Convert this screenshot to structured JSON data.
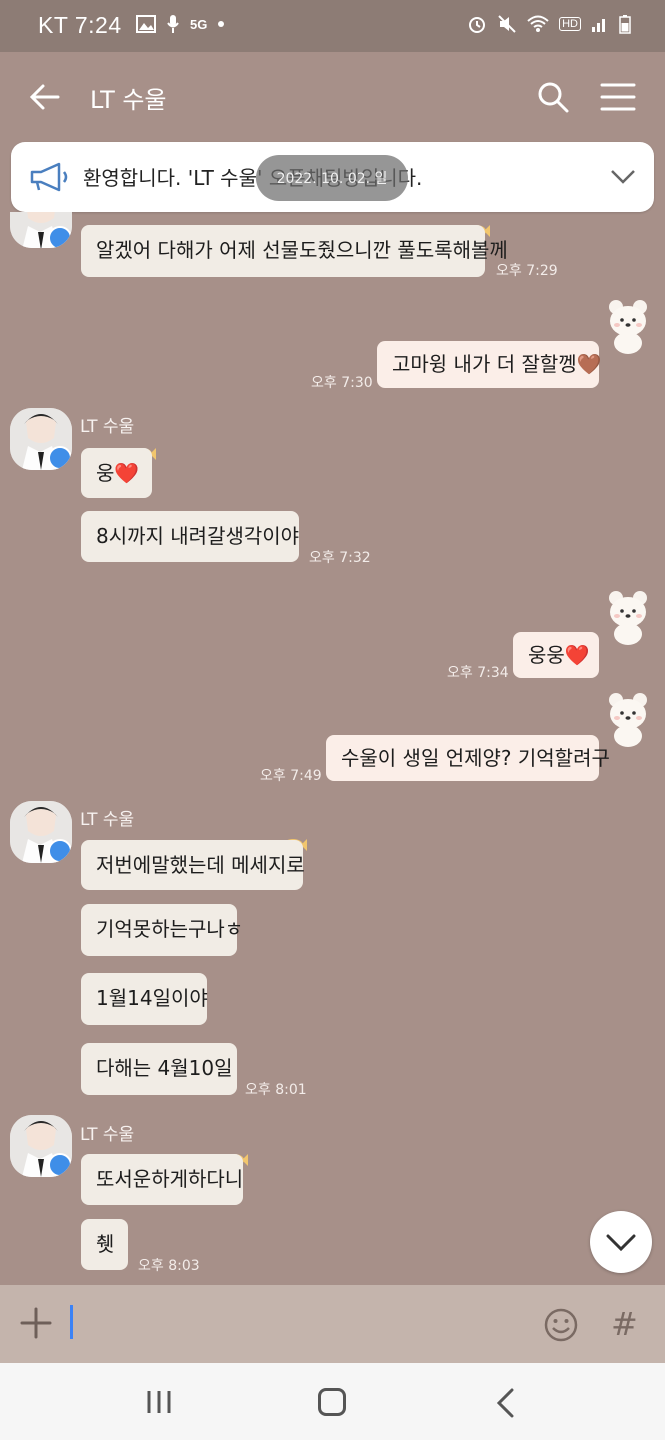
{
  "status_bar": {
    "carrier_time": "KT 7:24",
    "network_badge": "5G",
    "hd_badge": "HD"
  },
  "app_bar": {
    "room_title": "LT 수울",
    "icons": [
      "back-arrow-icon",
      "search-icon",
      "menu-icon"
    ]
  },
  "notice": {
    "text": "환영합니다. 'LT 수울' 오픈채팅방입니다.",
    "date_pill": "2022. 10. 02. 일"
  },
  "messages": [
    {
      "side": "in",
      "text": "알겠어 다해가 어제 선물도줬으니깐 풀도록해볼께",
      "time": "오후 7:29"
    },
    {
      "side": "out",
      "text": "고마윙 내가 더 잘할껭",
      "heart": "🤎",
      "time": "오후 7:30"
    },
    {
      "side": "in",
      "sender": "LT 수울",
      "text": "웅",
      "heart": "❤️"
    },
    {
      "side": "in",
      "text": "8시까지 내려갈생각이야",
      "time": "오후 7:32"
    },
    {
      "side": "out",
      "text": "웅웅",
      "heart": "❤️",
      "time": "오후 7:34"
    },
    {
      "side": "out",
      "text": "수울이 생일 언제양? 기억할려구",
      "time": "오후 7:49"
    },
    {
      "side": "in",
      "sender": "LT 수울",
      "text": "저번에말했는데 메세지로"
    },
    {
      "side": "in",
      "text": "기억못하는구나ㅎ"
    },
    {
      "side": "in",
      "text": "1월14일이야"
    },
    {
      "side": "in",
      "text": "다해는 4월10일",
      "time": "오후 8:01"
    },
    {
      "side": "in",
      "sender": "LT 수울",
      "text": "또서운하게하다니"
    },
    {
      "side": "in",
      "text": "췟",
      "time": "오후 8:03"
    }
  ],
  "input_bar": {
    "value": "",
    "icons": [
      "plus-icon",
      "emoji-icon",
      "hash-icon"
    ],
    "hash_label": "#"
  },
  "colors": {
    "chat_background": "#a79089",
    "incoming_bubble": "#f1ece5",
    "outgoing_bubble": "#fbeee8",
    "verified_badge": "#3f8ee8"
  }
}
